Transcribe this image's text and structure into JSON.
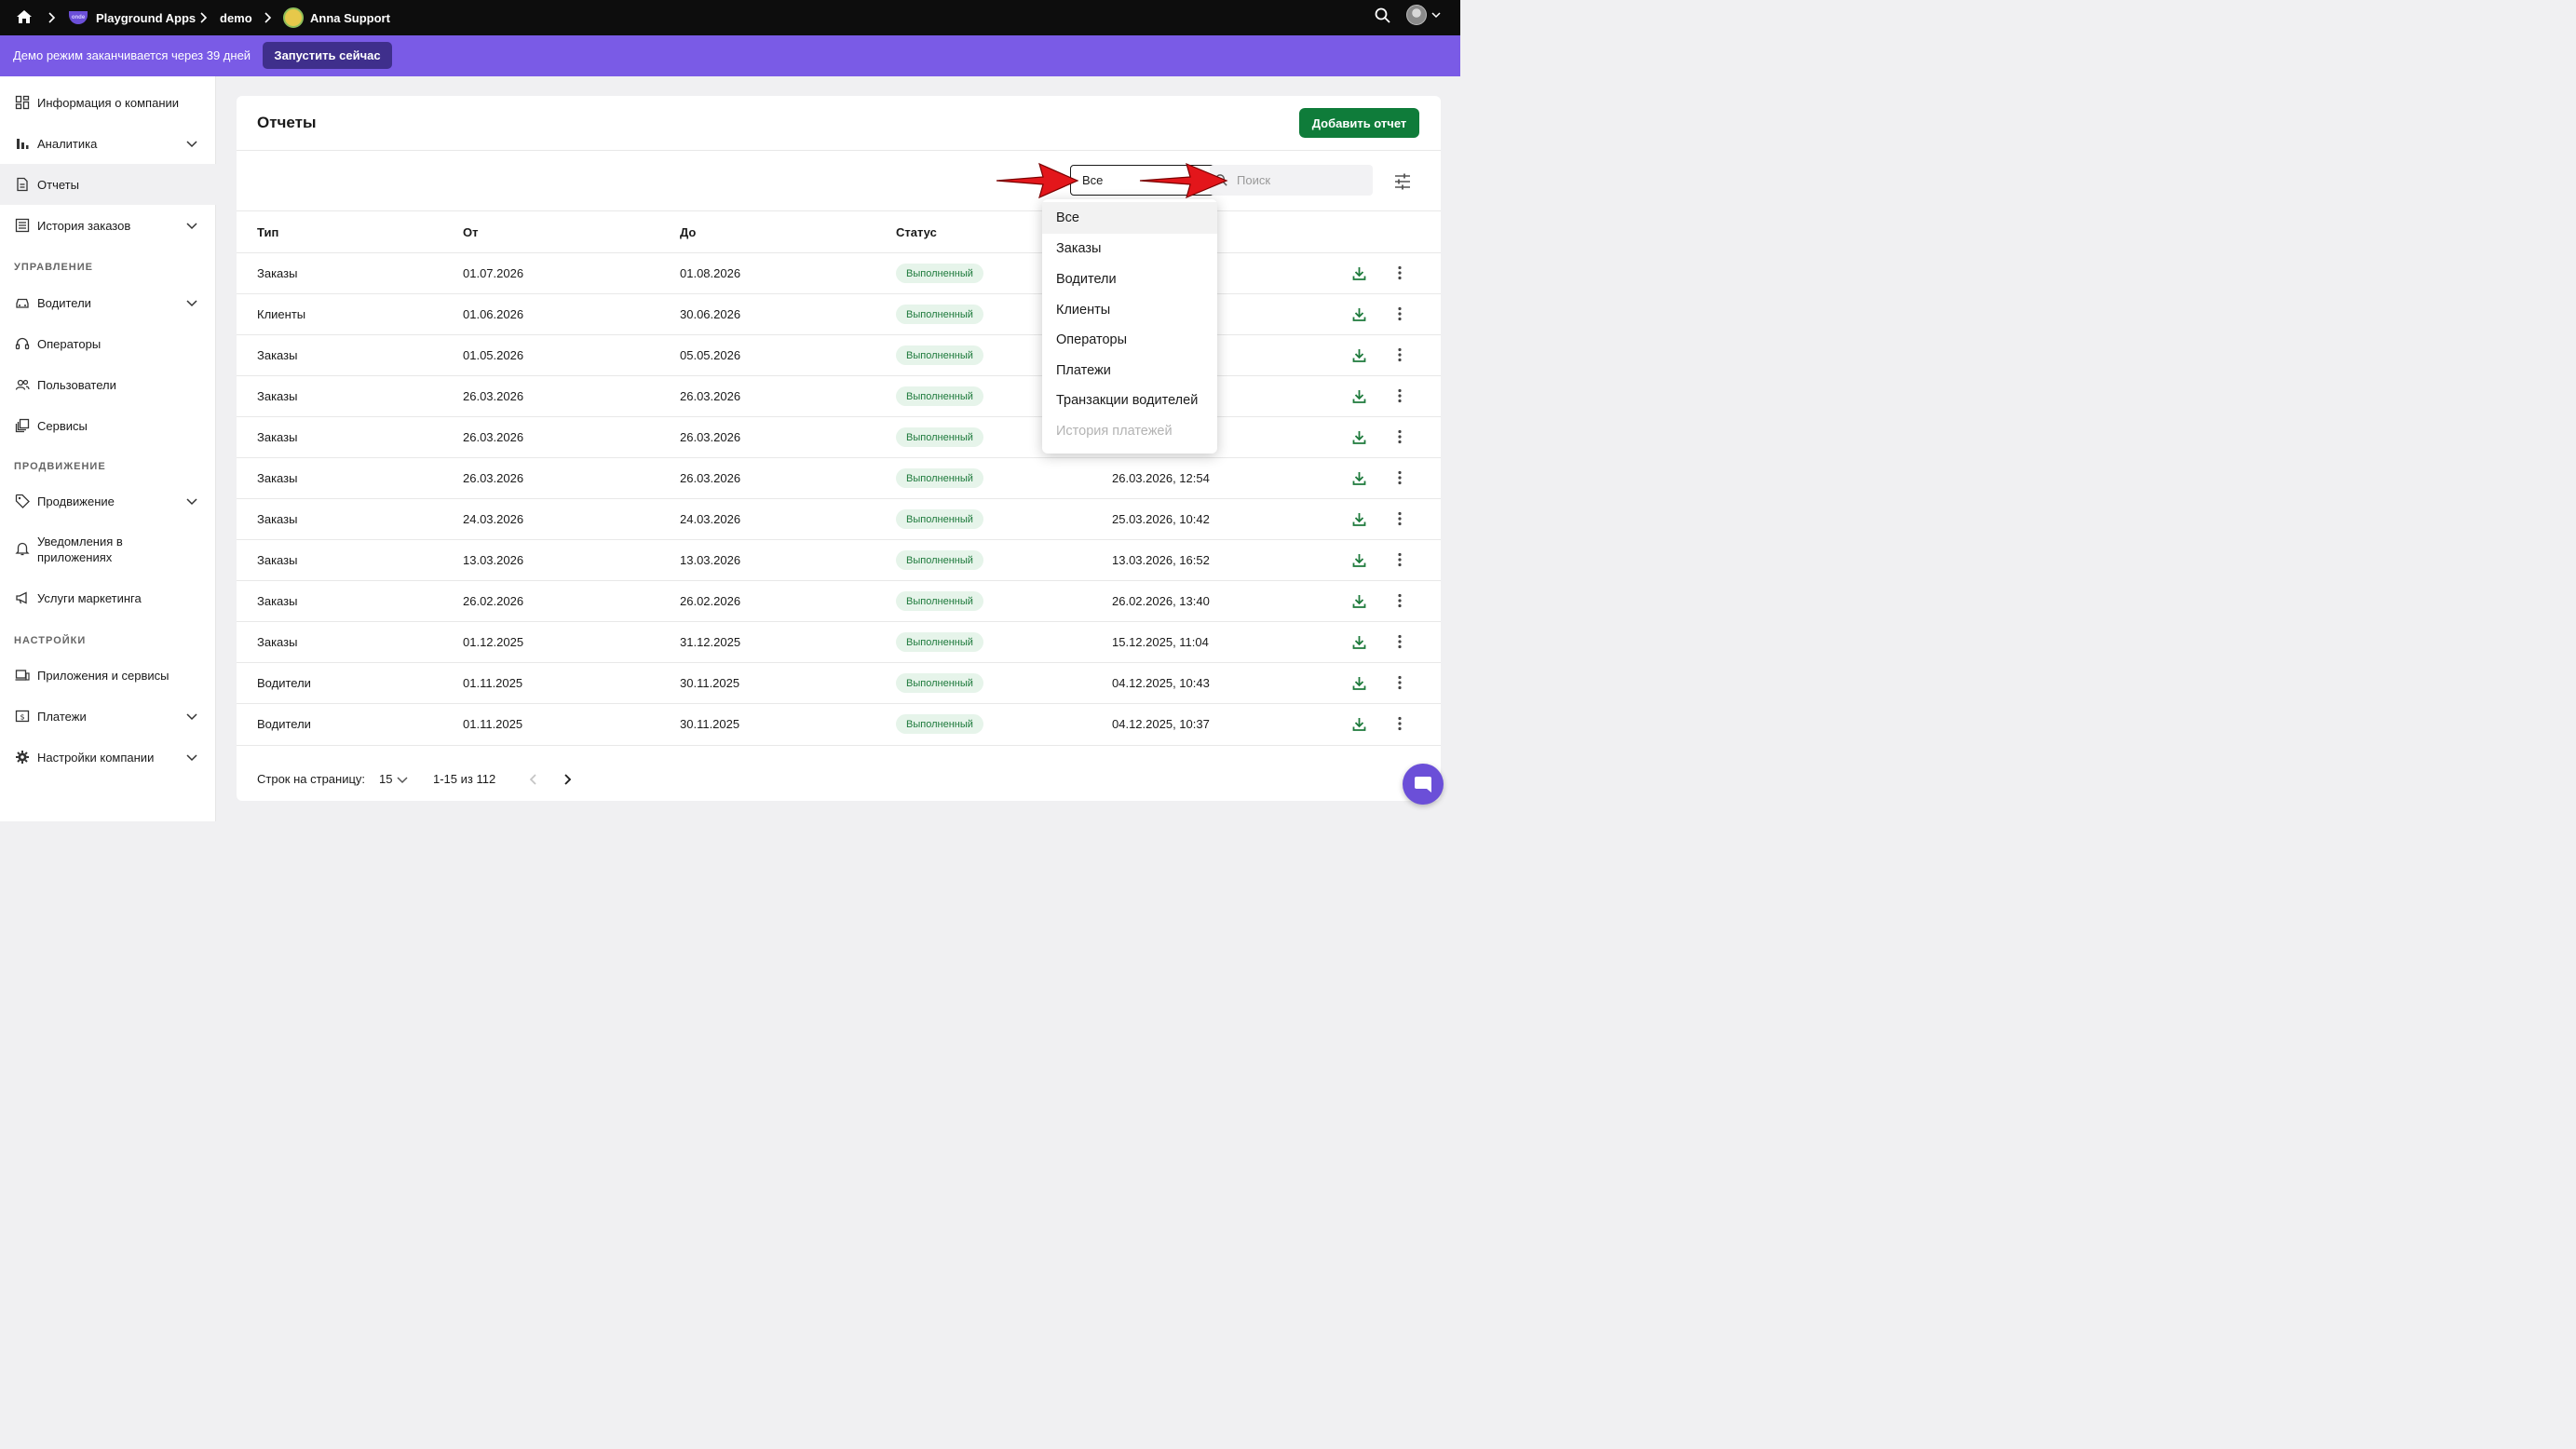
{
  "topbar": {
    "breadcrumbs": [
      "Playground Apps",
      "demo",
      "Anna Support"
    ],
    "app_logo_text": "onde"
  },
  "banner": {
    "text": "Демо режим заканчивается через 39 дней",
    "button": "Запустить сейчас"
  },
  "sidebar": {
    "items": [
      {
        "label": "Информация о компании",
        "icon": "grid-icon",
        "expandable": false
      },
      {
        "label": "Аналитика",
        "icon": "bar-chart-icon",
        "expandable": true
      },
      {
        "label": "Отчеты",
        "icon": "report-icon",
        "expandable": false,
        "active": true
      },
      {
        "label": "История заказов",
        "icon": "list-icon",
        "expandable": true
      }
    ],
    "section_management": "УПРАВЛЕНИЕ",
    "management": [
      {
        "label": "Водители",
        "icon": "car-icon",
        "expandable": true
      },
      {
        "label": "Операторы",
        "icon": "headset-icon",
        "expandable": false
      },
      {
        "label": "Пользователи",
        "icon": "users-icon",
        "expandable": false
      },
      {
        "label": "Сервисы",
        "icon": "layers-icon",
        "expandable": false
      }
    ],
    "section_promo": "ПРОДВИЖЕНИЕ",
    "promo": [
      {
        "label": "Продвижение",
        "icon": "tag-icon",
        "expandable": true
      },
      {
        "label": "Уведомления в приложениях",
        "icon": "bell-icon",
        "expandable": false
      },
      {
        "label": "Услуги маркетинга",
        "icon": "megaphone-icon",
        "expandable": false
      }
    ],
    "section_settings": "НАСТРОЙКИ",
    "settings": [
      {
        "label": "Приложения и сервисы",
        "icon": "devices-icon",
        "expandable": false
      },
      {
        "label": "Платежи",
        "icon": "dollar-icon",
        "expandable": true
      },
      {
        "label": "Настройки компании",
        "icon": "gear-icon",
        "expandable": true
      }
    ]
  },
  "page": {
    "title": "Отчеты",
    "add_button": "Добавить отчет",
    "filter_value": "Все",
    "search_placeholder": "Поиск"
  },
  "table": {
    "headers": [
      "Тип",
      "От",
      "До",
      "Статус"
    ],
    "rows": [
      {
        "type": "Заказы",
        "from": "01.07.2026",
        "to": "01.08.2026",
        "status": "Выполненный",
        "created": ""
      },
      {
        "type": "Клиенты",
        "from": "01.06.2026",
        "to": "30.06.2026",
        "status": "Выполненный",
        "created": ""
      },
      {
        "type": "Заказы",
        "from": "01.05.2026",
        "to": "05.05.2026",
        "status": "Выполненный",
        "created": ""
      },
      {
        "type": "Заказы",
        "from": "26.03.2026",
        "to": "26.03.2026",
        "status": "Выполненный",
        "created": ""
      },
      {
        "type": "Заказы",
        "from": "26.03.2026",
        "to": "26.03.2026",
        "status": "Выполненный",
        "created": ""
      },
      {
        "type": "Заказы",
        "from": "26.03.2026",
        "to": "26.03.2026",
        "status": "Выполненный",
        "created": "26.03.2026, 12:54"
      },
      {
        "type": "Заказы",
        "from": "24.03.2026",
        "to": "24.03.2026",
        "status": "Выполненный",
        "created": "25.03.2026, 10:42"
      },
      {
        "type": "Заказы",
        "from": "13.03.2026",
        "to": "13.03.2026",
        "status": "Выполненный",
        "created": "13.03.2026, 16:52"
      },
      {
        "type": "Заказы",
        "from": "26.02.2026",
        "to": "26.02.2026",
        "status": "Выполненный",
        "created": "26.02.2026, 13:40"
      },
      {
        "type": "Заказы",
        "from": "01.12.2025",
        "to": "31.12.2025",
        "status": "Выполненный",
        "created": "15.12.2025, 11:04"
      },
      {
        "type": "Водители",
        "from": "01.11.2025",
        "to": "30.11.2025",
        "status": "Выполненный",
        "created": "04.12.2025, 10:43"
      },
      {
        "type": "Водители",
        "from": "01.11.2025",
        "to": "30.11.2025",
        "status": "Выполненный",
        "created": "04.12.2025, 10:37"
      }
    ]
  },
  "pagination": {
    "rows_per_page_label": "Строк на страницу:",
    "rows_per_page": "15",
    "range": "1-15 из 112"
  },
  "dropdown": {
    "options": [
      "Все",
      "Заказы",
      "Водители",
      "Клиенты",
      "Операторы",
      "Платежи",
      "Транзакции водителей",
      "История платежей"
    ]
  },
  "colors": {
    "banner": "#7a5be6",
    "primary_green": "#0f7c3a",
    "arrow_red": "#e3161b"
  }
}
